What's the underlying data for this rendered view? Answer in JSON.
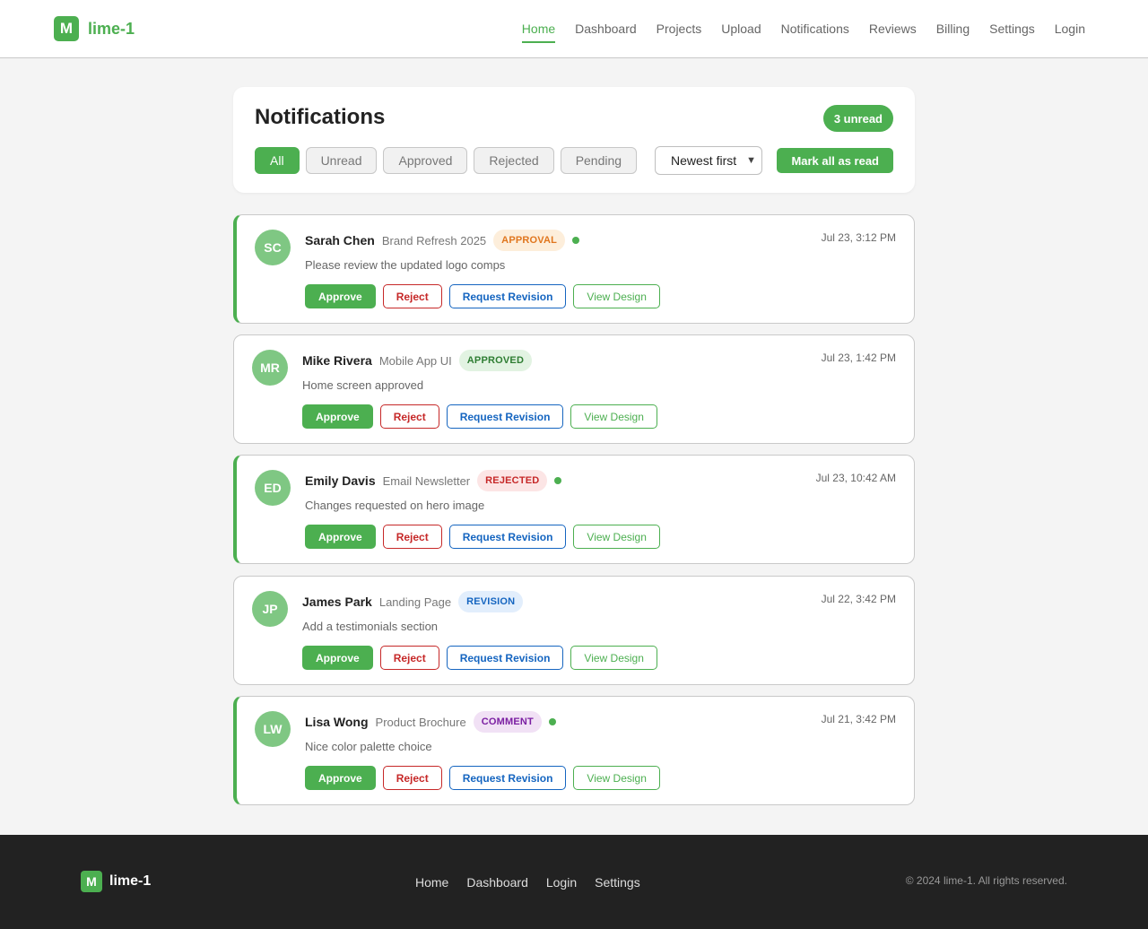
{
  "header": {
    "logo_glyph": "M",
    "brand": "lime-1",
    "nav": [
      "Home",
      "Dashboard",
      "Projects",
      "Upload",
      "Notifications",
      "Reviews",
      "Billing",
      "Settings",
      "Login"
    ],
    "active_nav": "Home"
  },
  "panel": {
    "title": "Notifications",
    "unread_badge": "3 unread",
    "filters": [
      "All",
      "Unread",
      "Approved",
      "Rejected",
      "Pending"
    ],
    "active_filter": "All",
    "sort_selected": "Newest first",
    "mark_all_label": "Mark all as read"
  },
  "notifications": [
    {
      "initials": "SC",
      "name": "Sarah Chen",
      "project": "Brand Refresh 2025",
      "tag": "APPROVAL",
      "tag_type": "approval",
      "unread": true,
      "time": "Jul 23, 3:12 PM",
      "message": "Please review the updated logo comps"
    },
    {
      "initials": "MR",
      "name": "Mike Rivera",
      "project": "Mobile App UI",
      "tag": "APPROVED",
      "tag_type": "approved",
      "unread": false,
      "time": "Jul 23, 1:42 PM",
      "message": "Home screen approved"
    },
    {
      "initials": "ED",
      "name": "Emily Davis",
      "project": "Email Newsletter",
      "tag": "REJECTED",
      "tag_type": "rejected",
      "unread": true,
      "time": "Jul 23, 10:42 AM",
      "message": "Changes requested on hero image"
    },
    {
      "initials": "JP",
      "name": "James Park",
      "project": "Landing Page",
      "tag": "REVISION",
      "tag_type": "revision",
      "unread": false,
      "time": "Jul 22, 3:42 PM",
      "message": "Add a testimonials section"
    },
    {
      "initials": "LW",
      "name": "Lisa Wong",
      "project": "Product Brochure",
      "tag": "COMMENT",
      "tag_type": "comment",
      "unread": true,
      "time": "Jul 21, 3:42 PM",
      "message": "Nice color palette choice"
    }
  ],
  "actions": {
    "approve": "Approve",
    "reject": "Reject",
    "revise": "Request Revision",
    "view": "View Design"
  },
  "footer": {
    "logo_glyph": "M",
    "brand": "lime-1",
    "links": [
      "Home",
      "Dashboard",
      "Login",
      "Settings"
    ],
    "copyright": "© 2024 lime-1. All rights reserved."
  },
  "colors": {
    "accent": "#4caf50",
    "footer_bg": "#222222"
  }
}
